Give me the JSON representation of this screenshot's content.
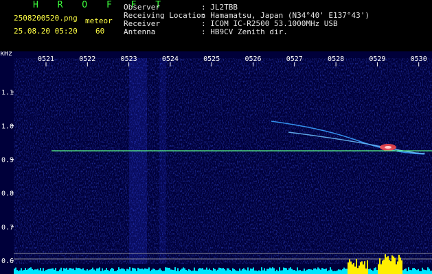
{
  "header": {
    "title": "H R O F F T",
    "filename": "2508200520.png",
    "datetime": "25.08.20 05:20",
    "mode": "meteor",
    "count": "60",
    "fields": [
      {
        "label": "Observer",
        "value": ": JL2TBB"
      },
      {
        "label": "Receiving Location",
        "value": ": Hamamatsu, Japan (N34°40' E137°43')"
      },
      {
        "label": "Receiver",
        "value": ": ICOM IC-R2500 53.1000MHz USB"
      },
      {
        "label": "Antenna",
        "value": ": HB9CV Zenith dir."
      }
    ]
  },
  "chart_data": {
    "type": "heatmap",
    "ylabel": "kHz",
    "x_ticks": [
      "0521",
      "0522",
      "0523",
      "0524",
      "0525",
      "0526",
      "0527",
      "0528",
      "0529",
      "0530"
    ],
    "y_ticks": [
      "1.1",
      "1.0",
      "0.9",
      "0.8",
      "0.7",
      "0.6"
    ],
    "ylim": [
      0.59,
      1.2
    ],
    "carrier_khz": 0.925,
    "colors": {
      "background": "#00003a",
      "carrier": "#5cff8a",
      "trace": "#3aa0ff",
      "hot": "#ff4a4a",
      "level": "#00e5ff",
      "level_peak": "#ffee00"
    }
  }
}
